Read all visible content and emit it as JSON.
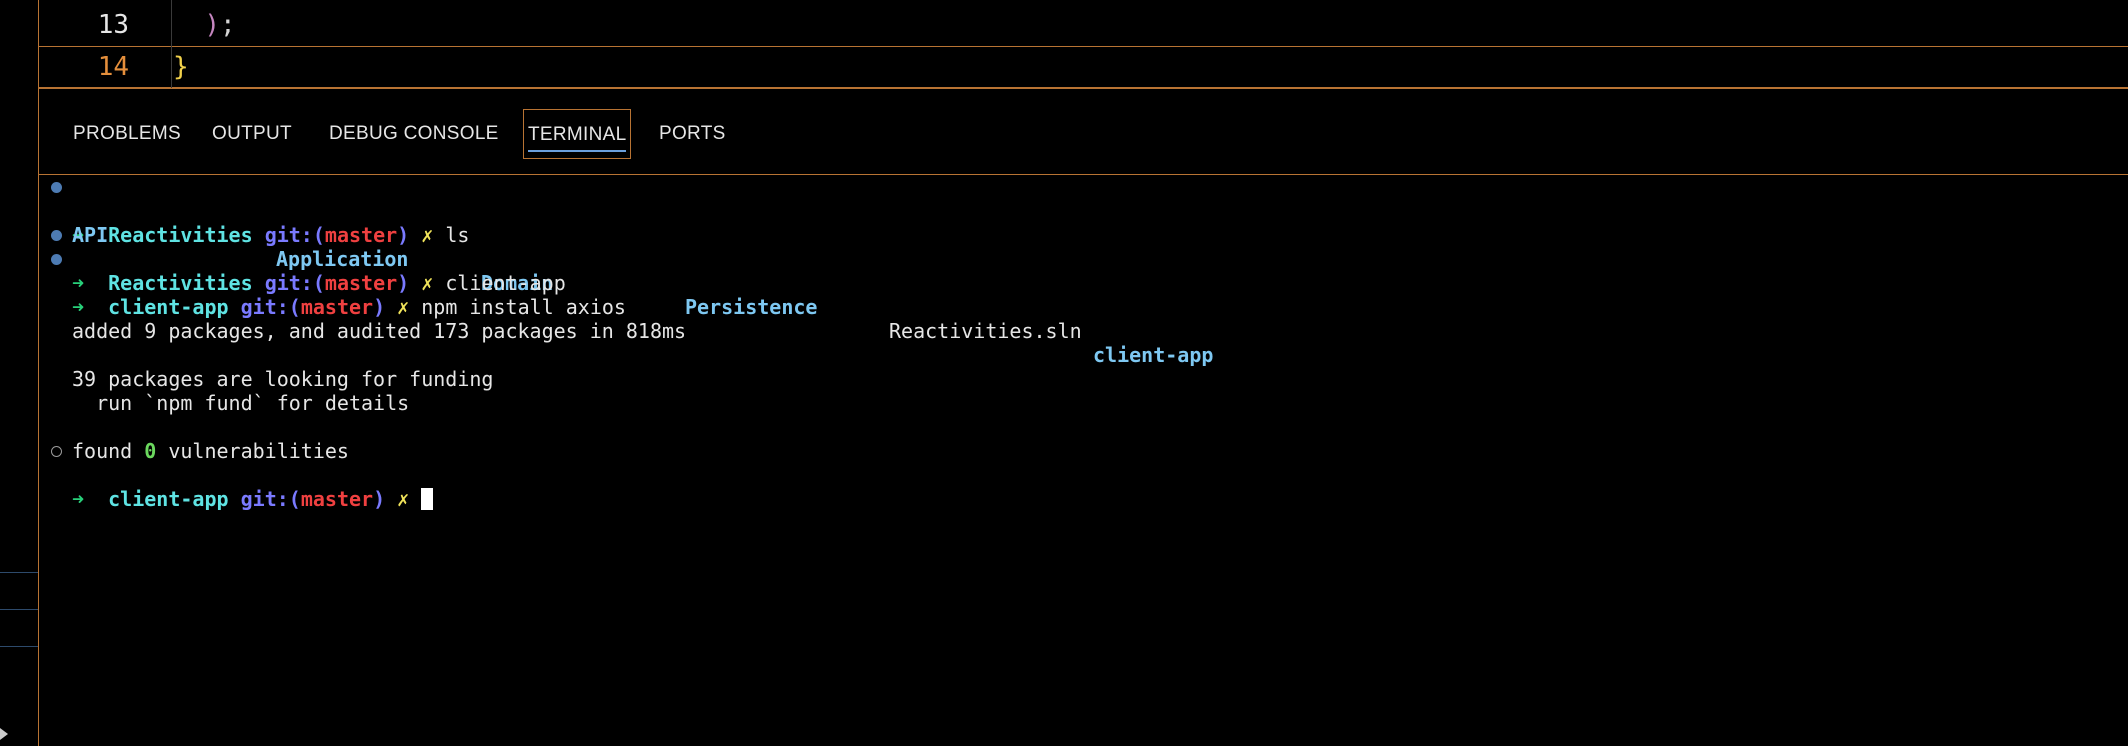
{
  "editor": {
    "lines": [
      {
        "number": "13",
        "code_open": "  ",
        "paren": ")",
        "semicolon": ";"
      },
      {
        "number": "14",
        "brace": "}"
      }
    ]
  },
  "panel": {
    "tabs": [
      {
        "label": "PROBLEMS"
      },
      {
        "label": "OUTPUT"
      },
      {
        "label": "DEBUG CONSOLE"
      },
      {
        "label": "TERMINAL",
        "active": true
      },
      {
        "label": "PORTS"
      }
    ]
  },
  "terminal": {
    "arrow": "➜",
    "git_prefix": "git:(",
    "git_suffix": ")",
    "branch": "master",
    "dirty": "✗",
    "prompts": [
      {
        "dir": "Reactivities",
        "command": "ls"
      },
      {
        "dir": "Reactivities",
        "command": "client-app"
      },
      {
        "dir": "client-app",
        "command": "npm install axios"
      },
      {
        "dir": "client-app",
        "command": ""
      }
    ],
    "ls_entries": [
      "API",
      "Application",
      "Domain",
      "Persistence",
      "Reactivities.sln",
      "client-app"
    ],
    "output": {
      "added": "added 9 packages, and audited 173 packages in 818ms",
      "funding": "39 packages are looking for funding",
      "fund_hint": "  run `npm fund` for details",
      "found_prefix": "found ",
      "found_count": "0",
      "found_suffix": " vulnerabilities"
    }
  },
  "colors": {
    "accent_border": "#b87333",
    "dir": "#5fe3e3",
    "branch": "#ef4040",
    "git": "#7a7aff",
    "arrow": "#28d07a"
  }
}
